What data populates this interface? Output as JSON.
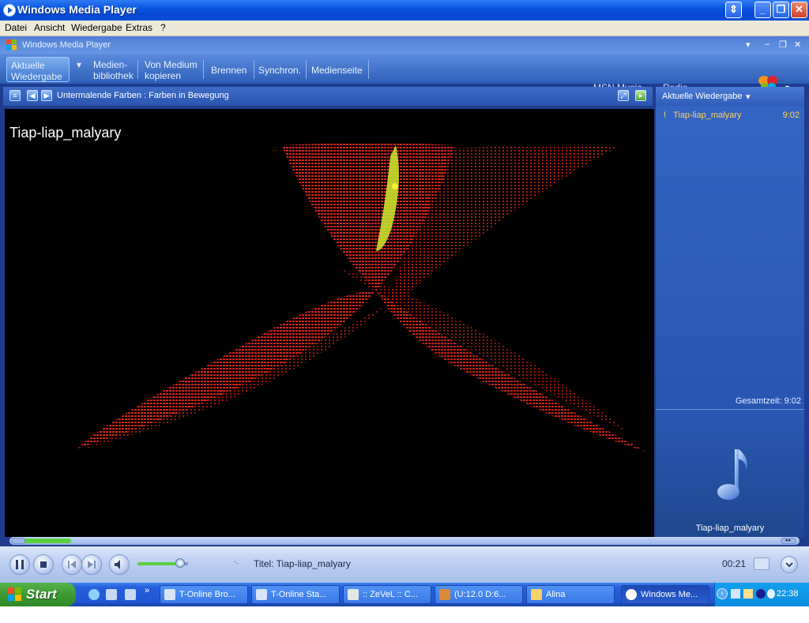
{
  "window": {
    "title": "Windows Media Player"
  },
  "menu": [
    "Datei",
    "Ansicht",
    "Wiedergabe",
    "Extras",
    "?"
  ],
  "wmp": {
    "label": "Windows Media Player",
    "tabs": [
      {
        "line1": "Aktuelle",
        "line2": "Wiedergabe"
      },
      {
        "line1": "Medien-",
        "line2": "bibliothek"
      },
      {
        "line1": "Von Medium",
        "line2": "kopieren"
      },
      {
        "line1": "Brennen",
        "line2": ""
      },
      {
        "line1": "Synchron.",
        "line2": ""
      },
      {
        "line1": "Medienseite",
        "line2": ""
      }
    ],
    "right_tabs": [
      "MSN Music",
      "Radio"
    ],
    "msn_logo": "msn"
  },
  "infobar": {
    "visualization": "Untermalende Farben : Farben in Bewegung"
  },
  "viz": {
    "song_title": "Tiap-liap_malyary"
  },
  "playlist": {
    "header": "Aktuelle Wiedergabe",
    "items": [
      {
        "marker": "!",
        "title": "Tiap-liap_malyary",
        "duration": "9:02"
      }
    ],
    "total": "Gesamtzeit: 9:02",
    "album_title": "Tiap-liap_malyary"
  },
  "controls": {
    "title_text": "Titel: Tiap-liap_malyary",
    "time": "00:21",
    "seek_fraction": 0.04,
    "volume_fraction": 0.85
  },
  "taskbar": {
    "start": "Start",
    "buttons": [
      "T-Online Bro...",
      "T-Online Sta...",
      ":: ZeVeL :: C...",
      "(U:12.0 D:6...",
      "Alina",
      "Windows Me..."
    ],
    "clock": "22:38"
  },
  "colors": {
    "accent": "#2a55b0",
    "highlight": "#ffd15c",
    "viz_red": "#e0261c",
    "viz_yellow": "#c8e030"
  }
}
